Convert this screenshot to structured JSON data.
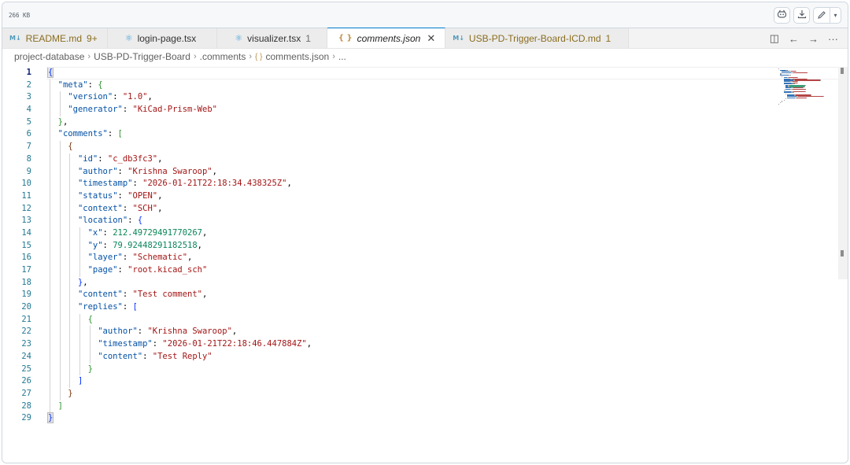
{
  "filebar": {
    "size": "266 KB",
    "icons": [
      "copilot-icon",
      "download-icon",
      "pencil-icon",
      "chevron-down-icon"
    ]
  },
  "tabs": [
    {
      "label": "README.md",
      "badge": "9+",
      "icon": "M↓",
      "state": "modified"
    },
    {
      "label": "login-page.tsx",
      "badge": "",
      "icon": "⚛",
      "state": "normal"
    },
    {
      "label": "visualizer.tsx",
      "badge": "1",
      "icon": "⚛",
      "state": "normal"
    },
    {
      "label": "comments.json",
      "badge": "",
      "icon": "{ }",
      "state": "active"
    },
    {
      "label": "USB-PD-Trigger-Board-ICD.md",
      "badge": "1",
      "icon": "M↓",
      "state": "modified"
    }
  ],
  "tab_actions": {
    "split": "◫",
    "back": "←",
    "forward": "→",
    "more": "···"
  },
  "breadcrumb": [
    "project-database",
    "USB-PD-Trigger-Board",
    ".comments",
    "comments.json",
    "..."
  ],
  "editor": {
    "current_line": 1,
    "line_numbers": [
      "1",
      "2",
      "3",
      "4",
      "5",
      "6",
      "7",
      "8",
      "9",
      "10",
      "11",
      "12",
      "13",
      "14",
      "15",
      "16",
      "17",
      "18",
      "19",
      "20",
      "21",
      "22",
      "23",
      "24",
      "25",
      "26",
      "27",
      "28",
      "29"
    ],
    "lines": [
      [
        [
          "b1",
          "{"
        ]
      ],
      [
        [
          "p",
          "  "
        ],
        [
          "k",
          "\"meta\""
        ],
        [
          "p",
          ": "
        ],
        [
          "b2",
          "{"
        ]
      ],
      [
        [
          "p",
          "    "
        ],
        [
          "k",
          "\"version\""
        ],
        [
          "p",
          ": "
        ],
        [
          "s",
          "\"1.0\""
        ],
        [
          "p",
          ","
        ]
      ],
      [
        [
          "p",
          "    "
        ],
        [
          "k",
          "\"generator\""
        ],
        [
          "p",
          ": "
        ],
        [
          "s",
          "\"KiCad-Prism-Web\""
        ]
      ],
      [
        [
          "p",
          "  "
        ],
        [
          "b2",
          "}"
        ],
        [
          "p",
          ","
        ]
      ],
      [
        [
          "p",
          "  "
        ],
        [
          "k",
          "\"comments\""
        ],
        [
          "p",
          ": "
        ],
        [
          "b2",
          "["
        ]
      ],
      [
        [
          "p",
          "    "
        ],
        [
          "b3",
          "{"
        ]
      ],
      [
        [
          "p",
          "      "
        ],
        [
          "k",
          "\"id\""
        ],
        [
          "p",
          ": "
        ],
        [
          "s",
          "\"c_db3fc3\""
        ],
        [
          "p",
          ","
        ]
      ],
      [
        [
          "p",
          "      "
        ],
        [
          "k",
          "\"author\""
        ],
        [
          "p",
          ": "
        ],
        [
          "s",
          "\"Krishna Swaroop\""
        ],
        [
          "p",
          ","
        ]
      ],
      [
        [
          "p",
          "      "
        ],
        [
          "k",
          "\"timestamp\""
        ],
        [
          "p",
          ": "
        ],
        [
          "s",
          "\"2026-01-21T22:18:34.438325Z\""
        ],
        [
          "p",
          ","
        ]
      ],
      [
        [
          "p",
          "      "
        ],
        [
          "k",
          "\"status\""
        ],
        [
          "p",
          ": "
        ],
        [
          "s",
          "\"OPEN\""
        ],
        [
          "p",
          ","
        ]
      ],
      [
        [
          "p",
          "      "
        ],
        [
          "k",
          "\"context\""
        ],
        [
          "p",
          ": "
        ],
        [
          "s",
          "\"SCH\""
        ],
        [
          "p",
          ","
        ]
      ],
      [
        [
          "p",
          "      "
        ],
        [
          "k",
          "\"location\""
        ],
        [
          "p",
          ": "
        ],
        [
          "b1",
          "{"
        ]
      ],
      [
        [
          "p",
          "        "
        ],
        [
          "k",
          "\"x\""
        ],
        [
          "p",
          ": "
        ],
        [
          "n",
          "212.49729491770267"
        ],
        [
          "p",
          ","
        ]
      ],
      [
        [
          "p",
          "        "
        ],
        [
          "k",
          "\"y\""
        ],
        [
          "p",
          ": "
        ],
        [
          "n",
          "79.92448291182518"
        ],
        [
          "p",
          ","
        ]
      ],
      [
        [
          "p",
          "        "
        ],
        [
          "k",
          "\"layer\""
        ],
        [
          "p",
          ": "
        ],
        [
          "s",
          "\"Schematic\""
        ],
        [
          "p",
          ","
        ]
      ],
      [
        [
          "p",
          "        "
        ],
        [
          "k",
          "\"page\""
        ],
        [
          "p",
          ": "
        ],
        [
          "s",
          "\"root.kicad_sch\""
        ]
      ],
      [
        [
          "p",
          "      "
        ],
        [
          "b1",
          "}"
        ],
        [
          "p",
          ","
        ]
      ],
      [
        [
          "p",
          "      "
        ],
        [
          "k",
          "\"content\""
        ],
        [
          "p",
          ": "
        ],
        [
          "s",
          "\"Test comment\""
        ],
        [
          "p",
          ","
        ]
      ],
      [
        [
          "p",
          "      "
        ],
        [
          "k",
          "\"replies\""
        ],
        [
          "p",
          ": "
        ],
        [
          "b1",
          "["
        ]
      ],
      [
        [
          "p",
          "        "
        ],
        [
          "b2",
          "{"
        ]
      ],
      [
        [
          "p",
          "          "
        ],
        [
          "k",
          "\"author\""
        ],
        [
          "p",
          ": "
        ],
        [
          "s",
          "\"Krishna Swaroop\""
        ],
        [
          "p",
          ","
        ]
      ],
      [
        [
          "p",
          "          "
        ],
        [
          "k",
          "\"timestamp\""
        ],
        [
          "p",
          ": "
        ],
        [
          "s",
          "\"2026-01-21T22:18:46.447884Z\""
        ],
        [
          "p",
          ","
        ]
      ],
      [
        [
          "p",
          "          "
        ],
        [
          "k",
          "\"content\""
        ],
        [
          "p",
          ": "
        ],
        [
          "s",
          "\"Test Reply\""
        ]
      ],
      [
        [
          "p",
          "        "
        ],
        [
          "b2",
          "}"
        ]
      ],
      [
        [
          "p",
          "      "
        ],
        [
          "b1",
          "]"
        ]
      ],
      [
        [
          "p",
          "    "
        ],
        [
          "b3",
          "}"
        ]
      ],
      [
        [
          "p",
          "  "
        ],
        [
          "b2",
          "]"
        ]
      ],
      [
        [
          "b1",
          "}"
        ]
      ]
    ]
  },
  "colors": {
    "key": "#0451a5",
    "string": "#a31515",
    "number": "#098658",
    "line_number": "#237893",
    "active_tab_border": "#007acc"
  }
}
